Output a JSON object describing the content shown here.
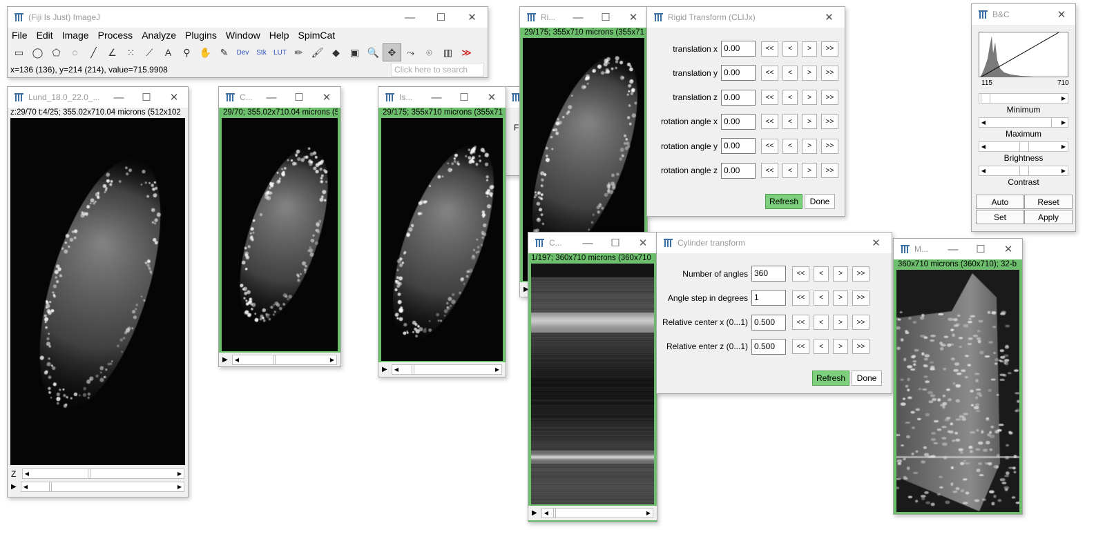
{
  "main": {
    "title": "(Fiji Is Just) ImageJ",
    "menus": [
      "File",
      "Edit",
      "Image",
      "Process",
      "Analyze",
      "Plugins",
      "Window",
      "Help",
      "SpimCat"
    ],
    "tools": [
      {
        "name": "rectangle-icon",
        "glyph": "▭"
      },
      {
        "name": "oval-icon",
        "glyph": "◯"
      },
      {
        "name": "polygon-icon",
        "glyph": "⬠"
      },
      {
        "name": "freehand-icon",
        "glyph": "◌"
      },
      {
        "name": "line-icon",
        "glyph": "╱"
      },
      {
        "name": "angle-icon",
        "glyph": "∠"
      },
      {
        "name": "multipoint-icon",
        "glyph": "⁙"
      },
      {
        "name": "wand-icon",
        "glyph": "⟋"
      },
      {
        "name": "text-icon",
        "glyph": "A"
      },
      {
        "name": "magnifier-icon",
        "glyph": "⚲"
      },
      {
        "name": "hand-icon",
        "glyph": "✋"
      },
      {
        "name": "color-picker-icon",
        "glyph": "✎"
      },
      {
        "name": "dev-menu-icon",
        "glyph": "Dev"
      },
      {
        "name": "stk-menu-icon",
        "glyph": "Stk"
      },
      {
        "name": "lut-menu-icon",
        "glyph": "LUT"
      },
      {
        "name": "pencil-icon",
        "glyph": "✏"
      },
      {
        "name": "brush-icon",
        "glyph": "🖌"
      },
      {
        "name": "fill-icon",
        "glyph": "◆"
      },
      {
        "name": "overlay-icon",
        "glyph": "▣"
      },
      {
        "name": "zoom-icon",
        "glyph": "🔍"
      },
      {
        "name": "move-icon",
        "glyph": "✥"
      },
      {
        "name": "script-icon",
        "glyph": "⤳"
      },
      {
        "name": "camera-icon",
        "glyph": "⌾"
      },
      {
        "name": "barcode-icon",
        "glyph": "▥"
      },
      {
        "name": "more-tools-icon",
        "glyph": "≫"
      }
    ],
    "status": "x=136 (136), y=214 (214), value=715.9908",
    "search_placeholder": "Click here to search"
  },
  "lund": {
    "title": "Lund_18.0_22.0_...",
    "info": "z:29/70 t:4/25; 355.02x710.04 microns (512x102",
    "z_label": "Z"
  },
  "c1": {
    "title": "C...",
    "info": "29/70; 355.02x710.04 microns (5"
  },
  "is1": {
    "title": "Is...",
    "info": "29/175; 355x710 microns (355x71"
  },
  "hidden": {
    "partial": "Fi"
  },
  "ri": {
    "title": "Ri...",
    "info": "29/175; 355x710 microns (355x71"
  },
  "rigid": {
    "title": "Rigid Transform (CLIJx)",
    "rows": [
      {
        "label": "translation x",
        "value": "0.00"
      },
      {
        "label": "translation y",
        "value": "0.00"
      },
      {
        "label": "translation z",
        "value": "0.00"
      },
      {
        "label": "rotation angle x",
        "value": "0.00"
      },
      {
        "label": "rotation angle y",
        "value": "0.00"
      },
      {
        "label": "rotation angle z",
        "value": "0.00"
      }
    ],
    "step_buttons": [
      "<<",
      "<",
      ">",
      ">>"
    ],
    "refresh": "Refresh",
    "done": "Done"
  },
  "c2": {
    "title": "C...",
    "info": "1/197; 360x710 microns (360x710"
  },
  "cyl": {
    "title": "Cylinder transform",
    "rows": [
      {
        "label": "Number of angles",
        "value": "360"
      },
      {
        "label": "Angle step in degrees",
        "value": "1"
      },
      {
        "label": "Relative center x (0...1)",
        "value": "0.500"
      },
      {
        "label": "Relative enter z (0...1)",
        "value": "0.500"
      }
    ],
    "step_buttons": [
      "<<",
      "<",
      ">",
      ">>"
    ],
    "refresh": "Refresh",
    "done": "Done"
  },
  "m": {
    "title": "M...",
    "info": "360x710 microns (360x710); 32-b"
  },
  "bc": {
    "title": "B&C",
    "hist_min": "115",
    "hist_max": "710",
    "labels": [
      "Minimum",
      "Maximum",
      "Brightness",
      "Contrast"
    ],
    "buttons": [
      "Auto",
      "Reset",
      "Set",
      "Apply"
    ]
  },
  "window_controls": {
    "minimize": "—",
    "maximize": "☐",
    "close": "✕"
  }
}
